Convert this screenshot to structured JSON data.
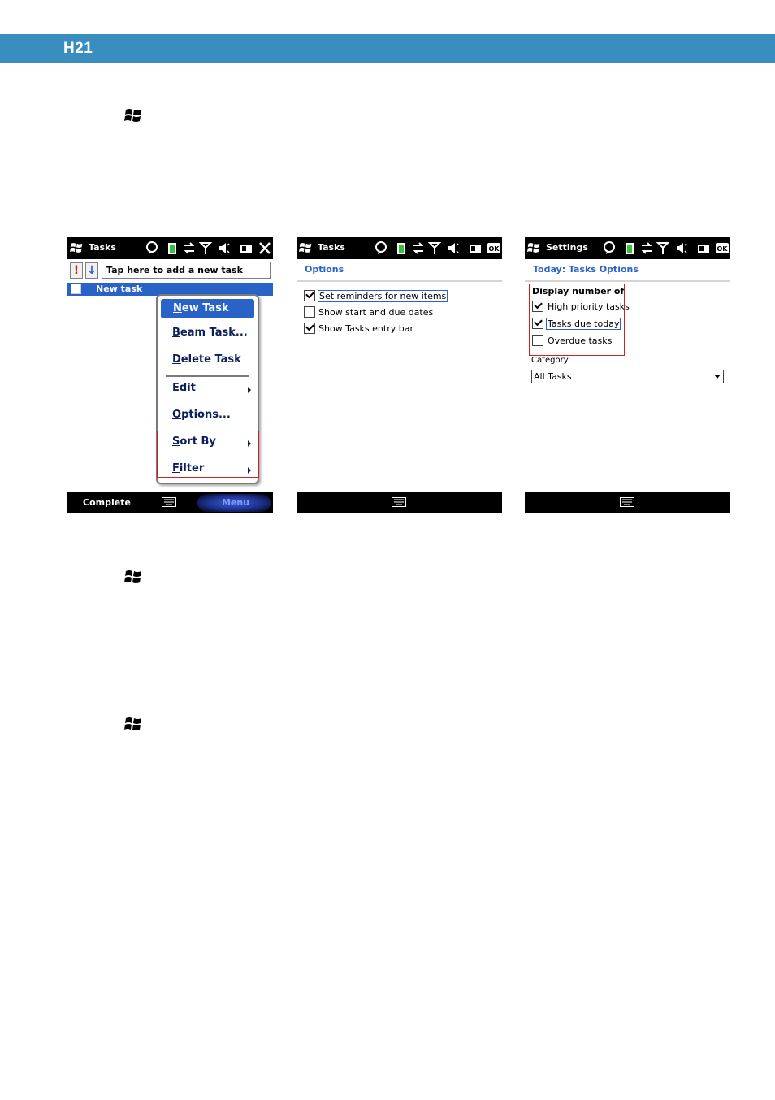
{
  "header": {
    "title": "H21"
  },
  "screen1": {
    "title": "Tasks",
    "input_text": "Tap here to add a new task",
    "priority_high": "!",
    "priority_low": "↓",
    "row_label": "New task",
    "menu": {
      "new_task": {
        "first": "N",
        "rest": "ew Task"
      },
      "beam_task": {
        "first": "B",
        "rest": "eam Task..."
      },
      "delete_task": {
        "first": "D",
        "rest": "elete Task"
      },
      "edit": {
        "first": "E",
        "rest": "dit"
      },
      "options": {
        "first": "O",
        "rest": "ptions..."
      },
      "sort_by": {
        "first": "S",
        "rest": "ort By"
      },
      "filter": {
        "first": "F",
        "rest": "ilter"
      }
    },
    "softkey_left": "Complete",
    "softkey_right": "Menu"
  },
  "screen2": {
    "title": "Tasks",
    "page_header": "Options",
    "options": [
      {
        "label": "Set reminders for new items",
        "checked": true
      },
      {
        "label": "Show start and due dates",
        "checked": false
      },
      {
        "label": "Show Tasks entry bar",
        "checked": true
      }
    ]
  },
  "screen3": {
    "title": "Settings",
    "page_header": "Today: Tasks Options",
    "section_label": "Display number of",
    "options": [
      {
        "label": "High priority tasks",
        "checked": true
      },
      {
        "label": "Tasks due today",
        "checked": true
      },
      {
        "label": "Overdue tasks",
        "checked": false
      }
    ],
    "category_label": "Category:",
    "category_value": "All Tasks"
  },
  "colors": {
    "header_bar": "#3a8dbf",
    "highlight": "#2a63c8",
    "callout": "#d11e1e"
  }
}
